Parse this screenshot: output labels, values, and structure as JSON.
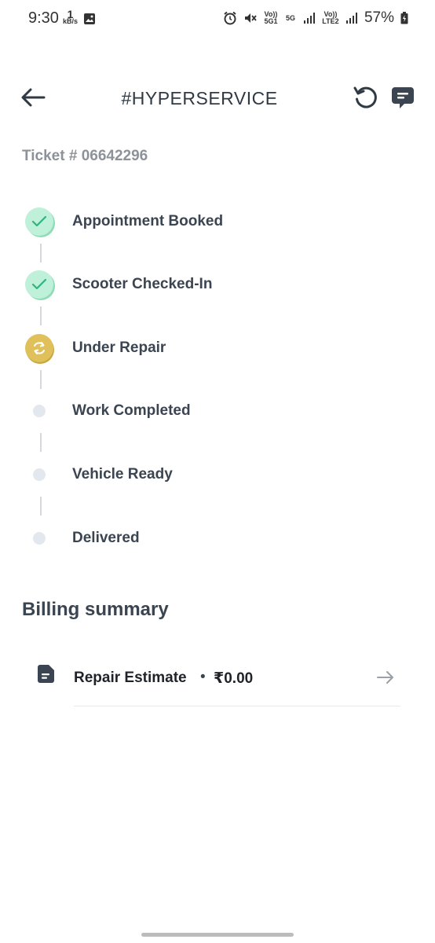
{
  "status_bar": {
    "time": "9:30",
    "speed_value": "1",
    "speed_unit": "kB/s",
    "net1": "Vo)) 5G1",
    "net2": "5G",
    "net3": "Vo)) LTE2",
    "battery": "57%"
  },
  "header": {
    "title": "#HYPERSERVICE"
  },
  "ticket": {
    "label": "Ticket # 06642296"
  },
  "timeline": {
    "steps": [
      {
        "label": "Appointment Booked",
        "state": "done"
      },
      {
        "label": "Scooter Checked-In",
        "state": "done"
      },
      {
        "label": "Under Repair",
        "state": "in-progress"
      },
      {
        "label": "Work Completed",
        "state": "pending"
      },
      {
        "label": "Vehicle Ready",
        "state": "pending"
      },
      {
        "label": "Delivered",
        "state": "pending"
      }
    ]
  },
  "billing": {
    "title": "Billing summary",
    "items": [
      {
        "label": "Repair Estimate",
        "separator": "•",
        "amount": "₹0.00"
      }
    ]
  },
  "icons": {
    "back": "arrow-left-icon",
    "refresh": "refresh-icon",
    "chat": "chat-icon",
    "check": "check-icon",
    "repair": "sync-icon",
    "document": "document-icon",
    "arrow": "arrow-right-icon"
  },
  "colors": {
    "done": "#bff0d9",
    "check": "#2fb47e",
    "in_progress": "#e0c05a",
    "pending": "#e3e8ee",
    "text": "#3b4451"
  }
}
